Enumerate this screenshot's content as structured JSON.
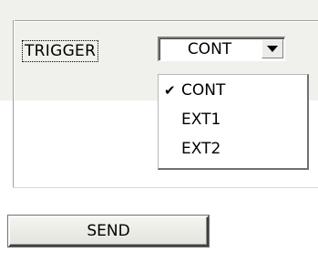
{
  "trigger": {
    "label": "TRIGGER",
    "selected_value": "CONT",
    "options": [
      {
        "label": "CONT",
        "checked": true,
        "check_mark": "✔"
      },
      {
        "label": "EXT1",
        "checked": false,
        "check_mark": ""
      },
      {
        "label": "EXT2",
        "checked": false,
        "check_mark": ""
      }
    ]
  },
  "send_button": {
    "label": "SEND"
  },
  "colors": {
    "panel_background": "#f0f0ec",
    "page_background": "#ffffff",
    "text": "#000000"
  }
}
